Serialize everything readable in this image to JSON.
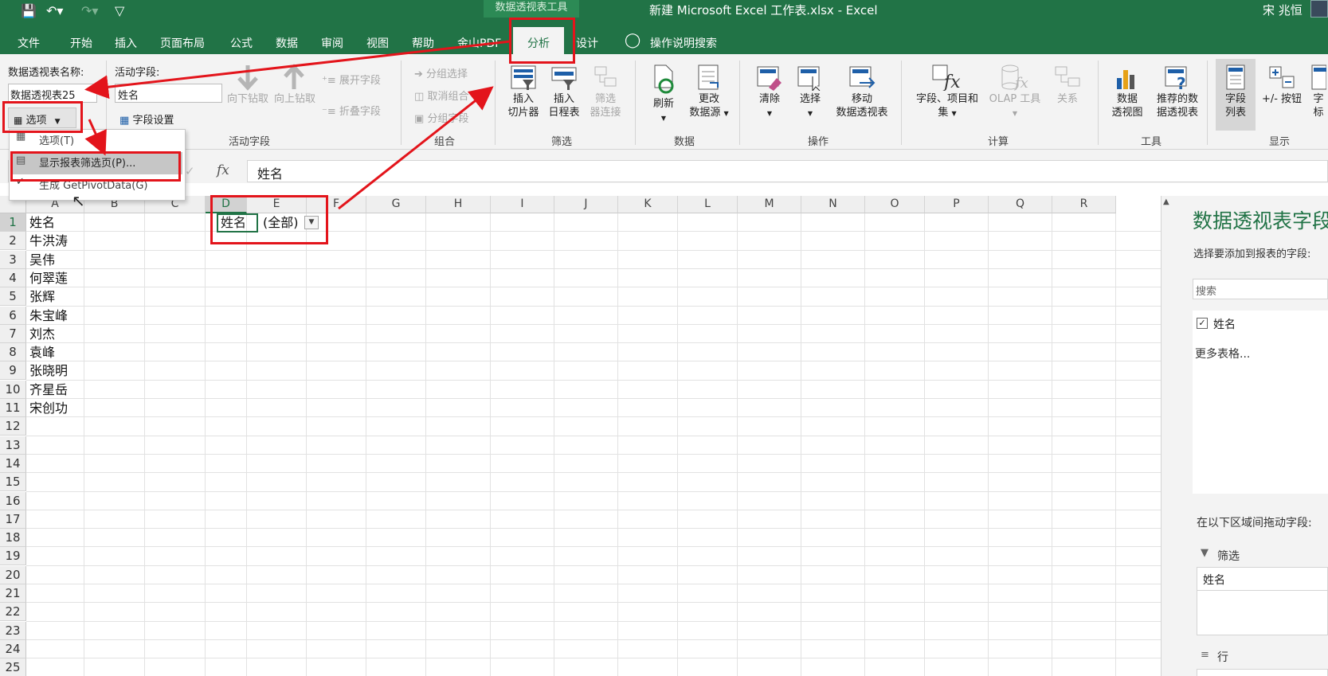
{
  "titlebar": {
    "contextual_tab_group": "数据透视表工具",
    "document_title": "新建 Microsoft Excel 工作表.xlsx  -  Excel",
    "user": "宋 兆恒"
  },
  "tabs": [
    "文件",
    "开始",
    "插入",
    "页面布局",
    "公式",
    "数据",
    "审阅",
    "视图",
    "帮助",
    "金山PDF",
    "分析",
    "设计",
    "操作说明搜索"
  ],
  "ribbon": {
    "pivot_name_label": "数据透视表名称:",
    "pivot_name_value": "数据透视表25",
    "options_button": "选项",
    "active_field_label": "活动字段:",
    "active_field_value": "姓名",
    "field_settings": "字段设置",
    "drill_down": "向下钻取",
    "drill_up": "向上钻取",
    "expand_field": "展开字段",
    "collapse_field": "折叠字段",
    "group_selection": "分组选择",
    "ungroup": "取消组合",
    "group_field": "分组字段",
    "insert_slicer": [
      "插入",
      "切片器"
    ],
    "insert_timeline": [
      "插入",
      "日程表"
    ],
    "filter_connections": [
      "筛选",
      "器连接"
    ],
    "refresh": "刷新",
    "change_source": [
      "更改",
      "数据源"
    ],
    "clear": "清除",
    "select": "选择",
    "move_pivot": [
      "移动",
      "数据透视表"
    ],
    "fields_items_sets": [
      "字段、项目和",
      "集"
    ],
    "olap_tools": "OLAP 工具",
    "relationships": "关系",
    "pivot_chart": [
      "数据",
      "透视图"
    ],
    "recommended_pivots": [
      "推荐的数",
      "据透视表"
    ],
    "field_list": [
      "字段",
      "列表"
    ],
    "plus_minus_buttons": "+/- 按钮",
    "field_headers": [
      "字",
      "标"
    ],
    "groups": {
      "active_field": "活动字段",
      "group": "组合",
      "filter": "筛选",
      "data": "数据",
      "actions": "操作",
      "calculations": "计算",
      "tools": "工具",
      "show": "显示"
    }
  },
  "options_menu": {
    "items": [
      "选项(T)",
      "显示报表筛选页(P)...",
      "生成 GetPivotData(G)"
    ]
  },
  "formula_bar": {
    "fx": "fx",
    "value": "姓名"
  },
  "grid": {
    "columns": [
      "A",
      "B",
      "C",
      "D",
      "E",
      "F",
      "G",
      "H",
      "I",
      "J",
      "K",
      "L",
      "M",
      "N",
      "O",
      "P",
      "Q",
      "R"
    ],
    "rows": [
      "1",
      "2",
      "3",
      "4",
      "5",
      "6",
      "7",
      "8",
      "9",
      "10",
      "11",
      "12",
      "13",
      "14",
      "15",
      "16",
      "17",
      "18",
      "19",
      "20",
      "21",
      "22",
      "23",
      "24",
      "25"
    ],
    "column_a": [
      "姓名",
      "牛洪涛",
      "吴伟",
      "何翠莲",
      "张辉",
      "朱宝峰",
      "刘杰",
      "袁峰",
      "张晓明",
      "齐星岳",
      "宋创功"
    ],
    "d1": "姓名",
    "e1": "(全部)"
  },
  "pane": {
    "title": "数据透视表字段",
    "choose_fields": "选择要添加到报表的字段:",
    "search_placeholder": "搜索",
    "field": "姓名",
    "more_tables": "更多表格...",
    "drag_hint": "在以下区域间拖动字段:",
    "filter_area": "筛选",
    "filter_item": "姓名",
    "rows_area": "行"
  },
  "colors": {
    "excel_green": "#217346",
    "ribbon_bg": "#f3f3f3",
    "annotation_red": "#e3141b"
  }
}
